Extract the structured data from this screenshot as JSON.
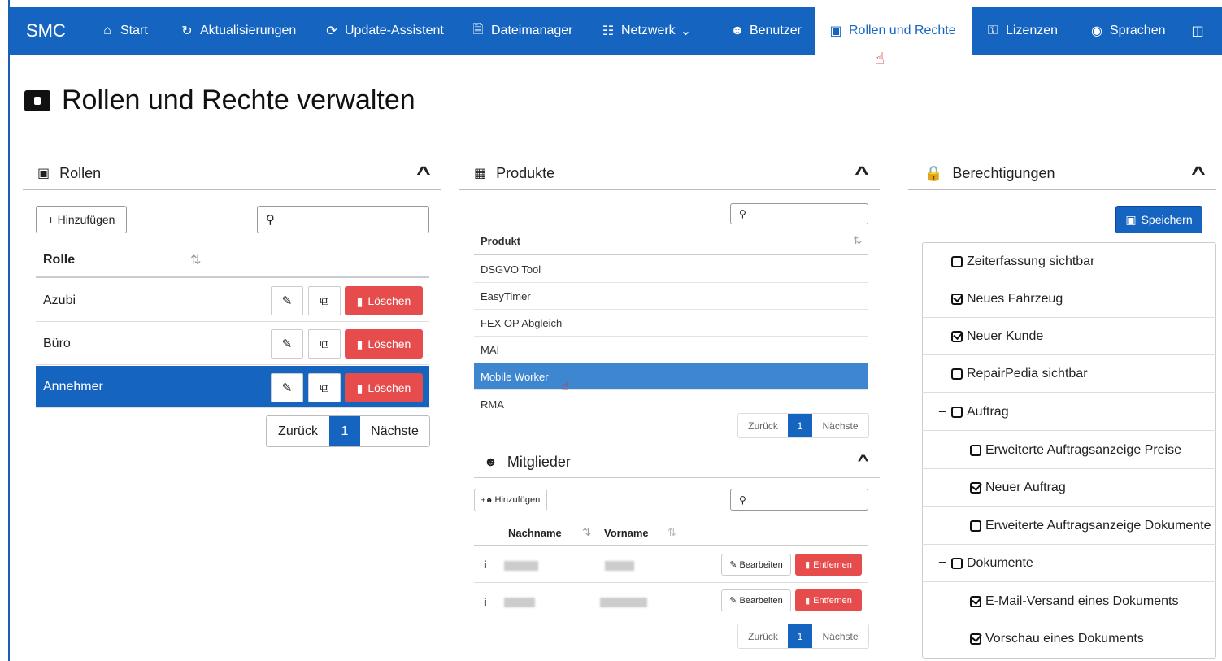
{
  "nav": {
    "brand": "SMC",
    "items": [
      {
        "label": "Start",
        "icon": "home-icon"
      },
      {
        "label": "Aktualisierungen",
        "icon": "refresh-icon"
      },
      {
        "label": "Update-Assistent",
        "icon": "update-icon"
      },
      {
        "label": "Dateimanager",
        "icon": "file-icon"
      },
      {
        "label": "Netzwerk",
        "icon": "network-icon"
      },
      {
        "label": "Benutzer",
        "icon": "users-icon"
      },
      {
        "label": "Rollen und Rechte",
        "icon": "roles-icon",
        "active": true
      },
      {
        "label": "Lizenzen",
        "icon": "key-icon"
      },
      {
        "label": "Sprachen",
        "icon": "globe-icon"
      }
    ]
  },
  "page": {
    "title": "Rollen und Rechte verwalten"
  },
  "roles": {
    "title": "Rollen",
    "add_label": "+ Hinzufügen",
    "search_placeholder": "",
    "column": "Rolle",
    "items": [
      "Azubi",
      "Büro",
      "Annehmer"
    ],
    "selected": "Annehmer",
    "delete_label": "Löschen",
    "pager": {
      "prev": "Zurück",
      "page": "1",
      "next": "Nächste"
    }
  },
  "products": {
    "title": "Produkte",
    "column": "Produkt",
    "items": [
      "DSGVO Tool",
      "EasyTimer",
      "FEX OP Abgleich",
      "MAI",
      "Mobile Worker",
      "RMA"
    ],
    "selected": "Mobile Worker",
    "pager": {
      "prev": "Zurück",
      "page": "1",
      "next": "Nächste"
    }
  },
  "members": {
    "title": "Mitglieder",
    "add_label": "Hinzufügen",
    "col_lastname": "Nachname",
    "col_firstname": "Vorname",
    "edit_label": "Bearbeiten",
    "remove_label": "Entfernen",
    "pager": {
      "prev": "Zurück",
      "page": "1",
      "next": "Nächste"
    }
  },
  "permissions": {
    "title": "Berechtigungen",
    "save_label": "Speichern",
    "items": [
      {
        "label": "Zeiterfassung sichtbar",
        "checked": false,
        "level": 0,
        "group": false
      },
      {
        "label": "Neues Fahrzeug",
        "checked": true,
        "level": 0,
        "group": false
      },
      {
        "label": "Neuer Kunde",
        "checked": true,
        "level": 0,
        "group": false
      },
      {
        "label": "RepairPedia sichtbar",
        "checked": false,
        "level": 0,
        "group": false
      },
      {
        "label": "Auftrag",
        "checked": false,
        "level": 0,
        "group": true
      },
      {
        "label": "Erweiterte Auftragsanzeige Preise",
        "checked": false,
        "level": 1,
        "group": false
      },
      {
        "label": "Neuer Auftrag",
        "checked": true,
        "level": 1,
        "group": false
      },
      {
        "label": "Erweiterte Auftragsanzeige Dokumente",
        "checked": false,
        "level": 1,
        "group": false
      },
      {
        "label": "Dokumente",
        "checked": false,
        "level": 0,
        "group": true
      },
      {
        "label": "E-Mail-Versand eines Dokuments",
        "checked": true,
        "level": 1,
        "group": false
      },
      {
        "label": "Vorschau eines Dokuments",
        "checked": true,
        "level": 1,
        "group": false
      }
    ]
  },
  "colors": {
    "primary": "#1565c0",
    "danger": "#e74c4c"
  }
}
